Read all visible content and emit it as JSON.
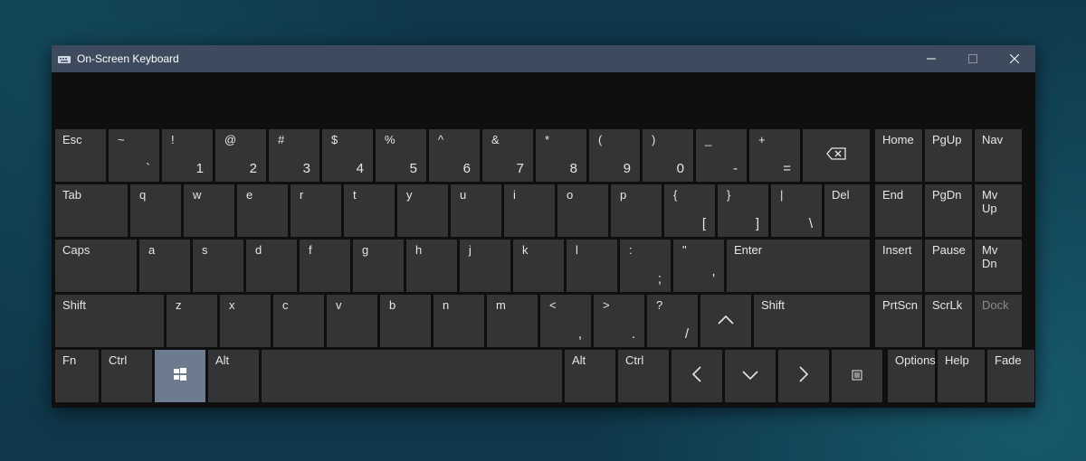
{
  "window": {
    "title": "On-Screen Keyboard"
  },
  "rows": {
    "r1": {
      "esc": "Esc",
      "numsUpper": [
        "~",
        "!",
        "@",
        "#",
        "$",
        "%",
        "^",
        "&",
        "*",
        "(",
        ")",
        "_",
        "+"
      ],
      "numsLower": [
        "`",
        "1",
        "2",
        "3",
        "4",
        "5",
        "6",
        "7",
        "8",
        "9",
        "0",
        "-",
        "="
      ],
      "backspace_icon": "backspace",
      "right": [
        "Home",
        "PgUp",
        "Nav"
      ]
    },
    "r2": {
      "tab": "Tab",
      "lettersUpper": [
        "",
        "",
        "",
        "",
        "",
        "",
        "",
        "",
        "",
        "",
        "{",
        "}",
        "|"
      ],
      "lettersLower": [
        "q",
        "w",
        "e",
        "r",
        "t",
        "y",
        "u",
        "i",
        "o",
        "p",
        "[",
        "]",
        "\\"
      ],
      "del": "Del",
      "right": [
        "End",
        "PgDn",
        "Mv Up"
      ]
    },
    "r3": {
      "caps": "Caps",
      "lettersLower": [
        "a",
        "s",
        "d",
        "f",
        "g",
        "h",
        "j",
        "k",
        "l"
      ],
      "punctUpper": [
        ":",
        "\""
      ],
      "punctLower": [
        ";",
        "'"
      ],
      "enter": "Enter",
      "right": [
        "Insert",
        "Pause",
        "Mv Dn"
      ]
    },
    "r4": {
      "shiftL": "Shift",
      "lettersLower": [
        "z",
        "x",
        "c",
        "v",
        "b",
        "n",
        "m"
      ],
      "punctUpper": [
        "<",
        ">",
        "?"
      ],
      "punctLower": [
        ",",
        ".",
        "/"
      ],
      "up_icon": "up",
      "shiftR": "Shift",
      "right": [
        "PrtScn",
        "ScrLk",
        "Dock"
      ]
    },
    "r5": {
      "fn": "Fn",
      "ctrlL": "Ctrl",
      "win_icon": "windows",
      "altL": "Alt",
      "altR": "Alt",
      "ctrlR": "Ctrl",
      "left_icon": "left",
      "down_icon": "down",
      "right_icon": "right",
      "menu_icon": "menu",
      "right": [
        "Options",
        "Help",
        "Fade"
      ]
    }
  }
}
